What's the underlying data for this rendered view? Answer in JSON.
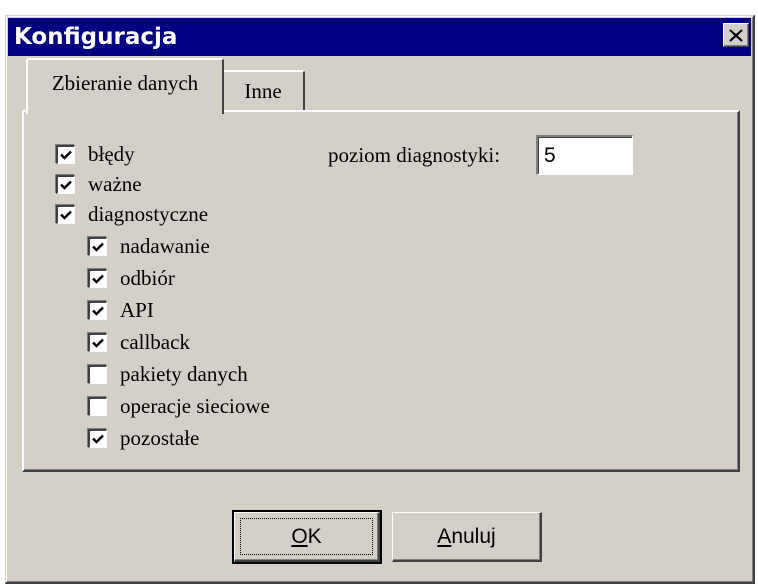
{
  "window": {
    "title": "Konfiguracja",
    "close_label": "Close"
  },
  "tabs": [
    {
      "label": "Zbieranie danych",
      "active": true
    },
    {
      "label": "Inne",
      "active": false
    }
  ],
  "checkboxes": [
    {
      "label": "błędy",
      "checked": true
    },
    {
      "label": "ważne",
      "checked": true
    },
    {
      "label": "diagnostyczne",
      "checked": true
    },
    {
      "label": "nadawanie",
      "checked": true
    },
    {
      "label": "odbiór",
      "checked": true
    },
    {
      "label": "API",
      "checked": true
    },
    {
      "label": "callback",
      "checked": true
    },
    {
      "label": "pakiety danych",
      "checked": false
    },
    {
      "label": "operacje sieciowe",
      "checked": false
    },
    {
      "label": "pozostałe",
      "checked": true
    }
  ],
  "diagnostics": {
    "label": "poziom diagnostyki:",
    "value": "5"
  },
  "buttons": {
    "ok_mnemonic": "O",
    "ok_rest": "K",
    "cancel_mnemonic": "A",
    "cancel_rest": "nuluj"
  }
}
